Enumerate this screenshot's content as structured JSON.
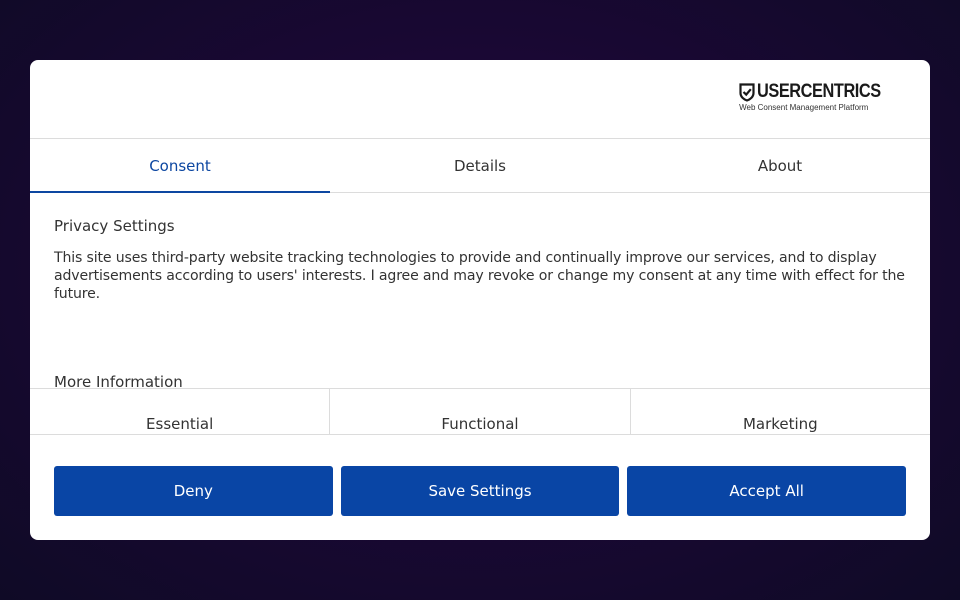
{
  "brand": {
    "name": "USERCENTRICS",
    "tagline": "Web Consent Management Platform",
    "icon": "shield-check-icon"
  },
  "tabs": [
    {
      "label": "Consent",
      "active": true
    },
    {
      "label": "Details",
      "active": false
    },
    {
      "label": "About",
      "active": false
    }
  ],
  "privacy": {
    "title": "Privacy Settings",
    "text": "This site uses third-party website tracking technologies to provide and continually improve our services, and to display advertisements according to users' interests. I agree and may revoke or change my consent at any time with effect for the future."
  },
  "more_info": {
    "label": "More Information"
  },
  "categories": [
    {
      "label": "Essential"
    },
    {
      "label": "Functional"
    },
    {
      "label": "Marketing"
    }
  ],
  "actions": {
    "deny_label": "Deny",
    "save_label": "Save Settings",
    "accept_label": "Accept All"
  },
  "colors": {
    "accent": "#0945a5",
    "active_tab": "#0d47a1",
    "backdrop": "#1a0834"
  }
}
